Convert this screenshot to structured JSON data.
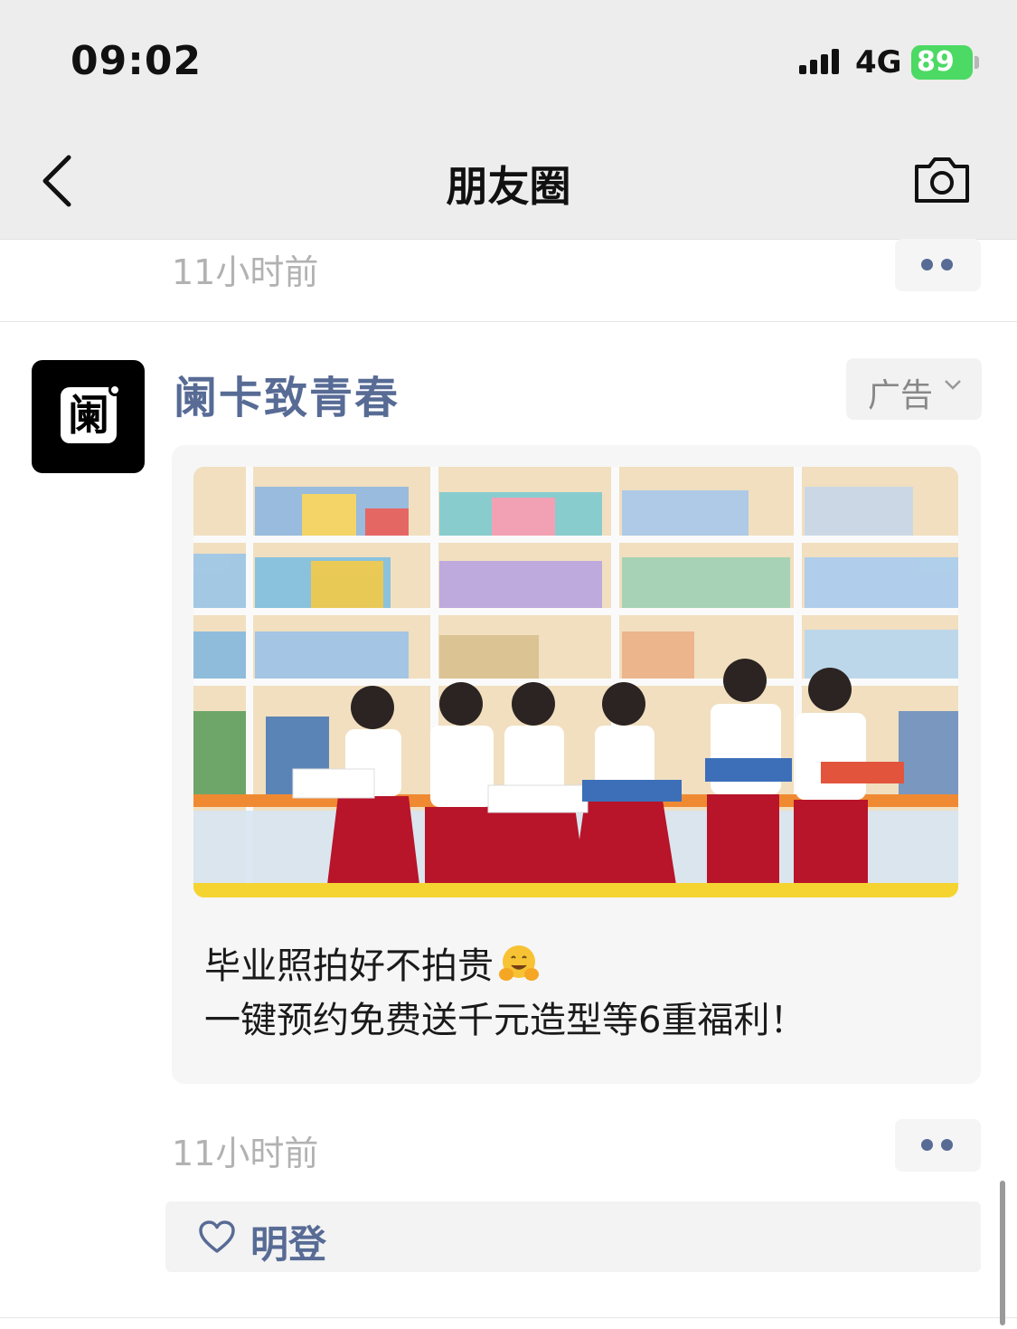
{
  "status_bar": {
    "time": "09:02",
    "network": "4G",
    "battery": "89"
  },
  "nav": {
    "title": "朋友圈",
    "back_icon": "chevron-left-icon",
    "camera_icon": "camera-icon"
  },
  "previous_post": {
    "timestamp": "11小时前"
  },
  "ad_post": {
    "author": "阑卡致青春",
    "avatar_glyph": "阑",
    "ad_label": "广告",
    "caption_line1": "毕业照拍好不拍贵",
    "caption_line2": "一键预约免费送千元造型等6重福利！",
    "emoji": "hugging-face-emoji",
    "timestamp": "11小时前",
    "likes": [
      "明登"
    ]
  },
  "colors": {
    "link_blue": "#576b95",
    "timestamp_gray": "#b2b2b2",
    "battery_green": "#4cd964"
  }
}
